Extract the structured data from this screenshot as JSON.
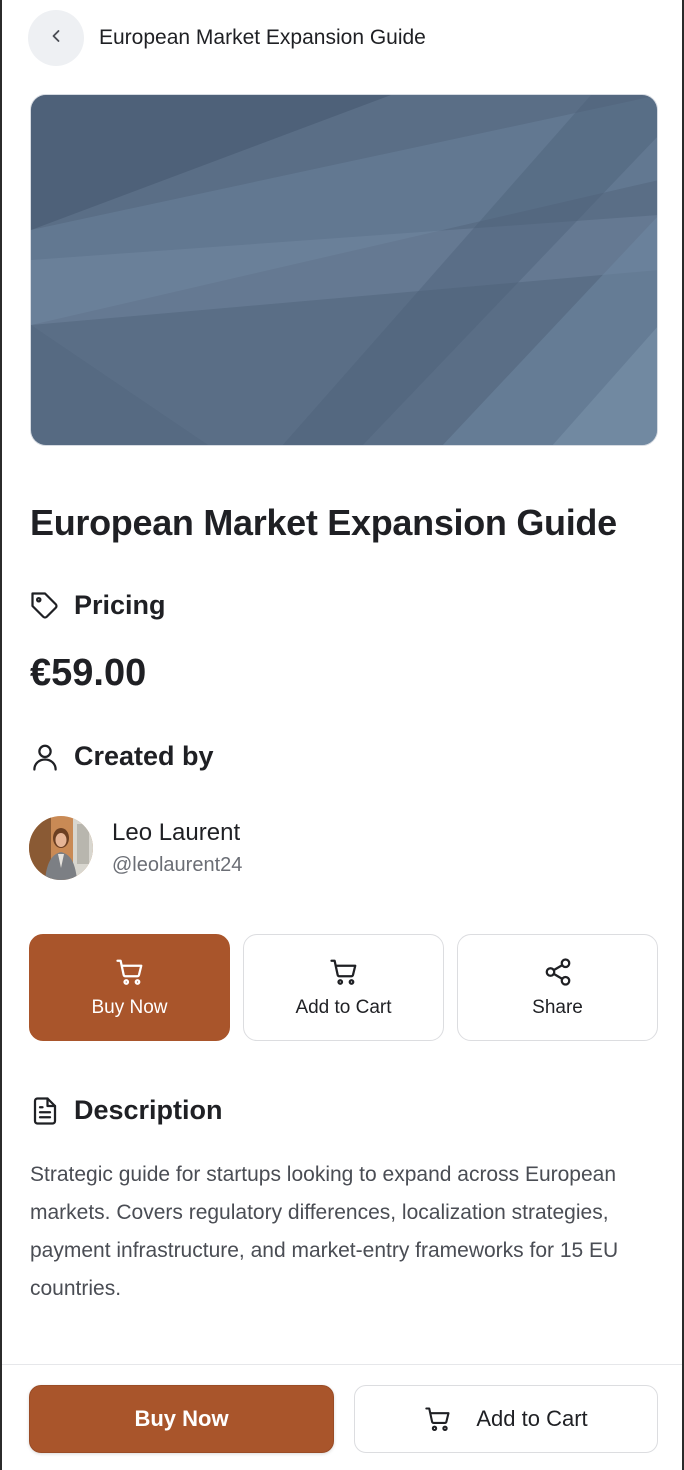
{
  "header": {
    "title": "European Market Expansion Guide",
    "back_icon": "chevron-left-icon"
  },
  "hero": {
    "colors": {
      "base": "#5a6e86",
      "light": "#7088a2",
      "dark": "#4a5c74"
    }
  },
  "product": {
    "title": "European Market Expansion Guide"
  },
  "pricing": {
    "label": "Pricing",
    "icon": "tag-icon",
    "price": "€59.00"
  },
  "creator": {
    "label": "Created by",
    "icon": "user-icon",
    "name": "Leo Laurent",
    "handle": "@leolaurent24"
  },
  "actions": {
    "buy_now": {
      "label": "Buy Now",
      "icon": "cart-icon"
    },
    "add_to_cart": {
      "label": "Add to Cart",
      "icon": "cart-icon"
    },
    "share": {
      "label": "Share",
      "icon": "share-icon"
    }
  },
  "description": {
    "label": "Description",
    "icon": "document-icon",
    "text": "Strategic guide for startups looking to expand across European markets. Covers regulatory differences, localization strategies, payment infrastructure, and market-entry frameworks for 15 EU countries."
  },
  "bottom_bar": {
    "buy_now": "Buy Now",
    "add_to_cart": "Add to Cart"
  },
  "theme": {
    "accent": "#a9552b",
    "text": "#1f2024",
    "muted": "#6b6e75"
  }
}
